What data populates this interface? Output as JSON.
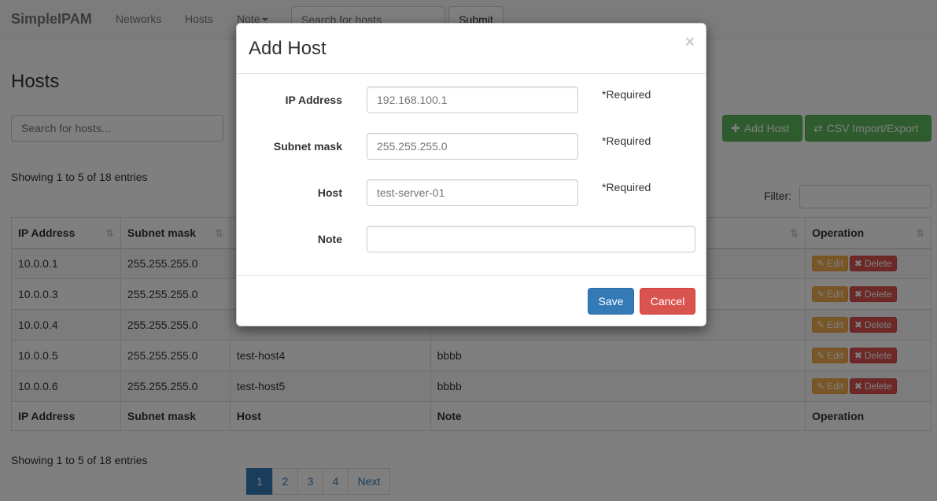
{
  "navbar": {
    "brand": "SimpleIPAM",
    "links": [
      "Networks",
      "Hosts",
      "Note"
    ],
    "search_placeholder": "Search for hosts",
    "submit_label": "Submit"
  },
  "page": {
    "title": "Hosts",
    "search_placeholder": "Search for hosts...",
    "add_host_label": "Add Host",
    "csv_label": "CSV Import/Export",
    "info_text": "Showing 1 to 5 of 18 entries",
    "filter_label": "Filter:"
  },
  "table": {
    "columns": [
      "IP Address",
      "Subnet mask",
      "Host",
      "Note",
      "Operation"
    ],
    "rows": [
      {
        "ip": "10.0.0.1",
        "mask": "255.255.255.0",
        "host": "",
        "note": ""
      },
      {
        "ip": "10.0.0.3",
        "mask": "255.255.255.0",
        "host": "",
        "note": ""
      },
      {
        "ip": "10.0.0.4",
        "mask": "255.255.255.0",
        "host": "",
        "note": ""
      },
      {
        "ip": "10.0.0.5",
        "mask": "255.255.255.0",
        "host": "test-host4",
        "note": "bbbb"
      },
      {
        "ip": "10.0.0.6",
        "mask": "255.255.255.0",
        "host": "test-host5",
        "note": "bbbb"
      }
    ],
    "edit_label": "Edit",
    "delete_label": "Delete"
  },
  "pagination": {
    "pages": [
      "1",
      "2",
      "3",
      "4"
    ],
    "active": "1",
    "next_label": "Next"
  },
  "modal": {
    "title": "Add Host",
    "close_symbol": "×",
    "fields": [
      {
        "label": "IP Address",
        "placeholder": "192.168.100.1",
        "hint": "*Required"
      },
      {
        "label": "Subnet mask",
        "placeholder": "255.255.255.0",
        "hint": "*Required"
      },
      {
        "label": "Host",
        "placeholder": "test-server-01",
        "hint": "*Required"
      },
      {
        "label": "Note",
        "placeholder": "",
        "hint": ""
      }
    ],
    "save_label": "Save",
    "cancel_label": "Cancel"
  }
}
